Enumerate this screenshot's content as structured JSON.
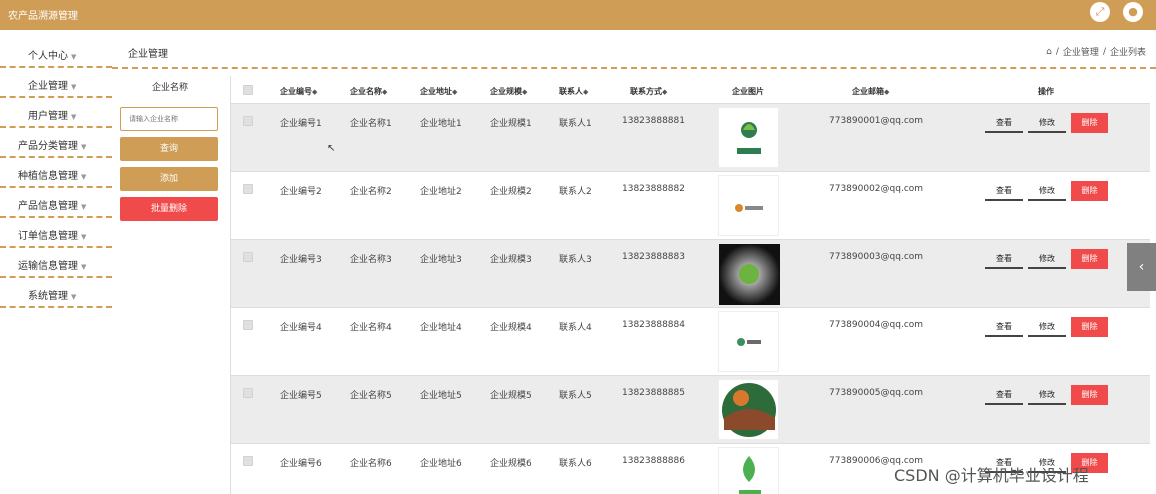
{
  "app": {
    "title": "农产品溯源管理"
  },
  "topbar": {
    "fullscreen_icon": "fullscreen-icon",
    "user_icon": "user-icon"
  },
  "sidebar": {
    "items": [
      {
        "label": "个人中心"
      },
      {
        "label": "企业管理"
      },
      {
        "label": "用户管理"
      },
      {
        "label": "产品分类管理"
      },
      {
        "label": "种植信息管理"
      },
      {
        "label": "产品信息管理"
      },
      {
        "label": "订单信息管理"
      },
      {
        "label": "运输信息管理"
      },
      {
        "label": "系统管理"
      }
    ]
  },
  "page": {
    "title": "企业管理"
  },
  "breadcrumb": {
    "home_icon": "home-icon",
    "sep": "/",
    "level1": "企业管理",
    "level2": "企业列表"
  },
  "filter": {
    "label": "企业名称",
    "placeholder": "请输入企业名称",
    "query": "查询",
    "add": "添加",
    "batch_delete": "批量删除"
  },
  "table": {
    "headers": {
      "code": "企业编号",
      "name": "企业名称",
      "address": "企业地址",
      "scale": "企业规模",
      "contact": "联系人",
      "phone": "联系方式",
      "image": "企业图片",
      "email": "企业邮箱",
      "ops": "操作"
    },
    "sort_glyph": "◆",
    "actions": {
      "view": "查看",
      "edit": "修改",
      "del": "删除"
    },
    "rows": [
      {
        "code": "企业编号1",
        "name": "企业名称1",
        "address": "企业地址1",
        "scale": "企业规模1",
        "contact": "联系人1",
        "phone": "13823888881",
        "email": "773890001@qq.com"
      },
      {
        "code": "企业编号2",
        "name": "企业名称2",
        "address": "企业地址2",
        "scale": "企业规模2",
        "contact": "联系人2",
        "phone": "13823888882",
        "email": "773890002@qq.com"
      },
      {
        "code": "企业编号3",
        "name": "企业名称3",
        "address": "企业地址3",
        "scale": "企业规模3",
        "contact": "联系人3",
        "phone": "13823888883",
        "email": "773890003@qq.com"
      },
      {
        "code": "企业编号4",
        "name": "企业名称4",
        "address": "企业地址4",
        "scale": "企业规模4",
        "contact": "联系人4",
        "phone": "13823888884",
        "email": "773890004@qq.com"
      },
      {
        "code": "企业编号5",
        "name": "企业名称5",
        "address": "企业地址5",
        "scale": "企业规模5",
        "contact": "联系人5",
        "phone": "13823888885",
        "email": "773890005@qq.com"
      },
      {
        "code": "企业编号6",
        "name": "企业名称6",
        "address": "企业地址6",
        "scale": "企业规模6",
        "contact": "联系人6",
        "phone": "13823888886",
        "email": "773890006@qq.com"
      }
    ]
  },
  "watermark": "CSDN @计算机毕业设计程",
  "colors": {
    "accent": "#cf9d55",
    "danger": "#f04a4a",
    "row_alt": "#ececec"
  }
}
